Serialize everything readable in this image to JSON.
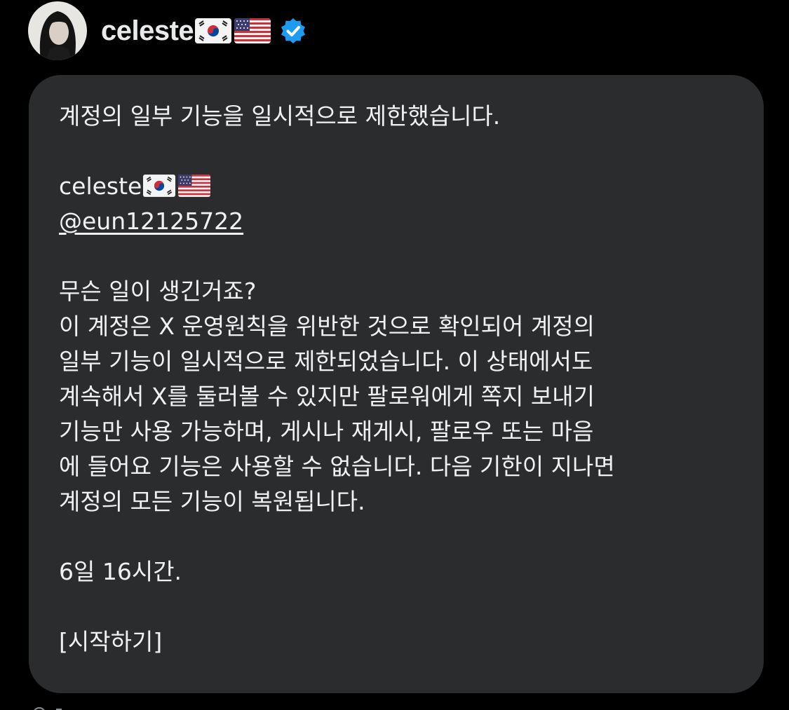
{
  "tweet": {
    "author": {
      "display_name": "celeste",
      "flags": [
        "south-korea-flag",
        "usa-flag"
      ],
      "verified": true,
      "verified_color": "#1d9bf0"
    }
  },
  "notice": {
    "title": "계정의 일부 기능을 일시적으로 제한했습니다.",
    "account_name": "celeste",
    "account_handle": "@eun12125722",
    "question": "무슨 일이 생긴거죠?",
    "body_lines": [
      "이 계정은 X 운영원칙을 위반한 것으로 확인되어 계정의",
      "일부 기능이 일시적으로 제한되었습니다. 이 상태에서도",
      "계속해서 X를 둘러볼 수 있지만 팔로워에게 쪽지 보내기",
      "기능만 사용 가능하며, 게시나 재게시, 팔로우 또는 마음",
      "에 들어요 기능은 사용할 수 없습니다. 다음 기한이 지나면",
      "계정의 모든 기능이 복원됩니다."
    ],
    "duration": "6일 16시간.",
    "action": "[시작하기]"
  },
  "colors": {
    "background": "#000000",
    "card": "#2a2c2e",
    "text": "#f1f1f1",
    "accent": "#1d9bf0"
  }
}
